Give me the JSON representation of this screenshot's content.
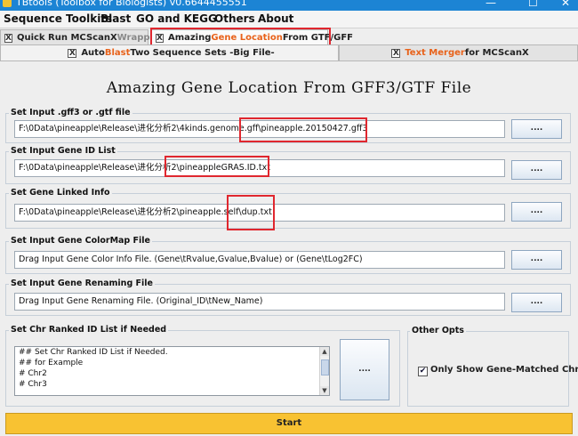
{
  "window": {
    "title": "TBtools (Toolbox for Biologists) v0.6644455551",
    "minimize": "—",
    "maximize": "☐",
    "close": "✕"
  },
  "menu": [
    "Sequence Toolkits",
    "Blast",
    "GO and KEGG",
    "Others",
    "About"
  ],
  "tabs_row1": [
    {
      "close": "X",
      "part1": "Quick Run MCScanX",
      "part2": " Wrapper"
    },
    {
      "close": "X",
      "part1": "Amazing ",
      "part2": "Gene Location",
      "part3": " From GTF/GFF"
    }
  ],
  "tabs_row2": [
    {
      "close": "X",
      "part1": "Auto ",
      "part2": "Blast",
      "part3": " Two Sequence Sets -Big File-"
    },
    {
      "close": "X",
      "part1": "Text Merger",
      "part2": " for MCScanX"
    }
  ],
  "page_title": "Amazing Gene Location From GFF3/GTF File",
  "sections": {
    "gff": {
      "label": "Set Input .gff3 or .gtf file",
      "value": "F:\\0Data\\pineapple\\Release\\进化分析2\\4kinds.genome.gff\\pineapple.20150427.gff3"
    },
    "geneid": {
      "label": "Set Input Gene ID List",
      "value": "F:\\0Data\\pineapple\\Release\\进化分析2\\pineappleGRAS.ID.txt"
    },
    "linked": {
      "label": "Set Gene Linked Info",
      "value": "F:\\0Data\\pineapple\\Release\\进化分析2\\pineapple.self\\dup.txt"
    },
    "colormap": {
      "label": "Set Input Gene ColorMap File",
      "value": "Drag Input Gene Color Info File. (Gene\\tRvalue,Gvalue,Bvalue) or (Gene\\tLog2FC)"
    },
    "renaming": {
      "label": "Set Input Gene Renaming File",
      "value": "Drag Input Gene Renaming File. (Original_ID\\tNew_Name)"
    },
    "chrlist": {
      "label": "Set Chr Ranked ID List if Needed",
      "lines": [
        "## Set Chr Ranked ID List if Needed.",
        "## for Example",
        "# Chr2",
        "# Chr3"
      ]
    }
  },
  "browse_label": "....",
  "other_opts": {
    "label": "Other Opts",
    "checkbox_label": "Only Show Gene-Matched Chr",
    "checked": "✔"
  },
  "start_label": "Start",
  "colors": {
    "accent_orange": "#e8621a",
    "highlight_red": "#e0272f",
    "start_yellow": "#f8c232",
    "titlebar_blue": "#1c84d4"
  }
}
